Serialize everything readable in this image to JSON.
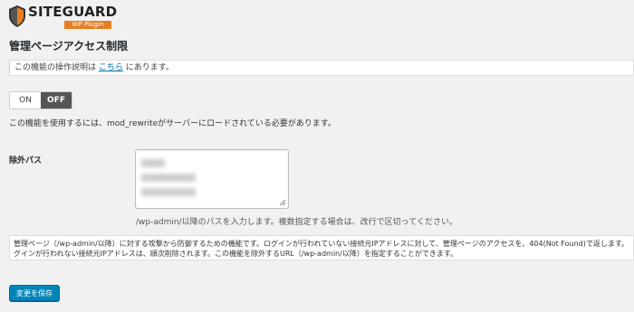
{
  "logo": {
    "name": "SITEGUARD",
    "subtitle": "WP Plugin"
  },
  "page": {
    "title": "管理ページアクセス制限"
  },
  "notice": {
    "prefix": "この機能の操作説明は ",
    "link": "こちら",
    "suffix": " にあります。"
  },
  "toggle": {
    "on_label": "ON",
    "off_label": "OFF",
    "selected": "OFF"
  },
  "requirement_text": "この機能を使用するには、mod_rewriteがサーバーにロードされている必要があります。",
  "exclude": {
    "label": "除外パス",
    "hint": "/wp-admin/以降のパスを入力します。複数指定する場合は、改行で区切ってください。"
  },
  "info": {
    "line1": "管理ページ（/wp-admin/以降）に対する攻撃から防御するための機能です。ログインが行われていない接続元IPアドレスに対して、管理ページのアクセスを、404(Not Found)で返します。",
    "line2": "グインが行われない接続元IPアドレスは、順次削除されます。この機能を除外するURL（/wp-admin/以降）を指定することができます。"
  },
  "save_label": "変更を保存",
  "colors": {
    "button": "#0085ba",
    "toggle_active": "#555555",
    "link": "#0073aa",
    "logo_accent": "#e67e22"
  }
}
